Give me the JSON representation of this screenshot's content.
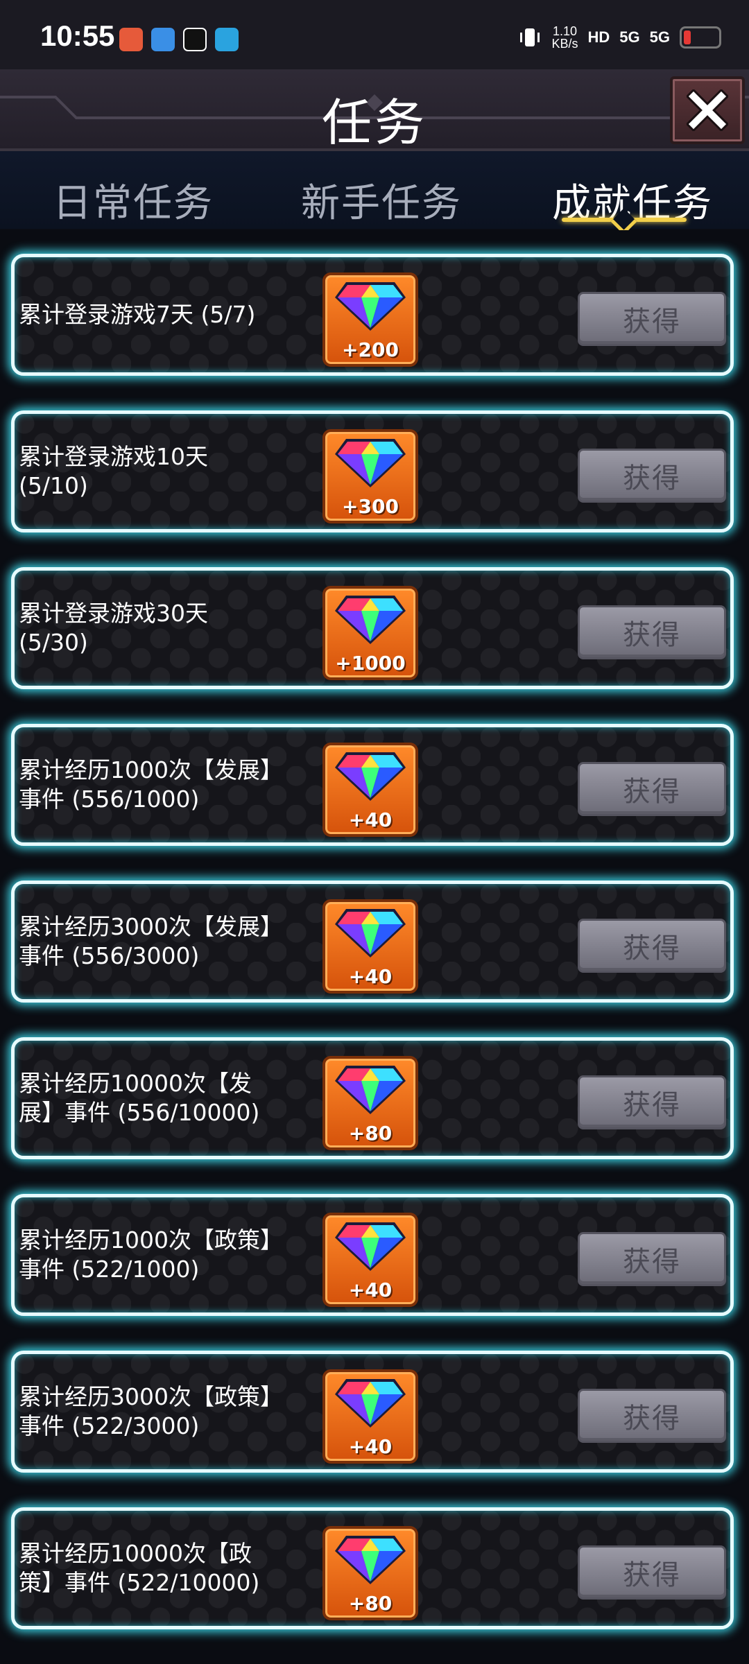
{
  "status_bar": {
    "time": "10:55",
    "net_speed_value": "1.10",
    "net_speed_unit": "KB/s",
    "hd_label": "HD",
    "signal1": "5G",
    "signal2": "5G"
  },
  "header": {
    "title": "任务"
  },
  "tabs": [
    {
      "label": "日常任务",
      "active": false
    },
    {
      "label": "新手任务",
      "active": false
    },
    {
      "label": "成就任务",
      "active": true
    }
  ],
  "tasks": [
    {
      "text": "累计登录游戏7天 (5/7)",
      "reward": "+200",
      "button": "获得"
    },
    {
      "text": "累计登录游戏10天\n (5/10)",
      "reward": "+300",
      "button": "获得"
    },
    {
      "text": "累计登录游戏30天\n (5/30)",
      "reward": "+1000",
      "button": "获得"
    },
    {
      "text": "累计经历1000次【发展】\n事件 (556/1000)",
      "reward": "+40",
      "button": "获得"
    },
    {
      "text": "累计经历3000次【发展】\n事件 (556/3000)",
      "reward": "+40",
      "button": "获得"
    },
    {
      "text": "累计经历10000次【发\n展】事件 (556/10000)",
      "reward": "+80",
      "button": "获得"
    },
    {
      "text": "累计经历1000次【政策】\n事件 (522/1000)",
      "reward": "+40",
      "button": "获得"
    },
    {
      "text": "累计经历3000次【政策】\n事件 (522/3000)",
      "reward": "+40",
      "button": "获得"
    },
    {
      "text": "累计经历10000次【政\n策】事件 (522/10000)",
      "reward": "+80",
      "button": "获得"
    }
  ],
  "colors": {
    "card_glow": "#3bcfe0",
    "reward_bg": "#ff8a2a",
    "button_bg": "#9b9aa6",
    "active_tab_underline": "#f2cf4a"
  }
}
